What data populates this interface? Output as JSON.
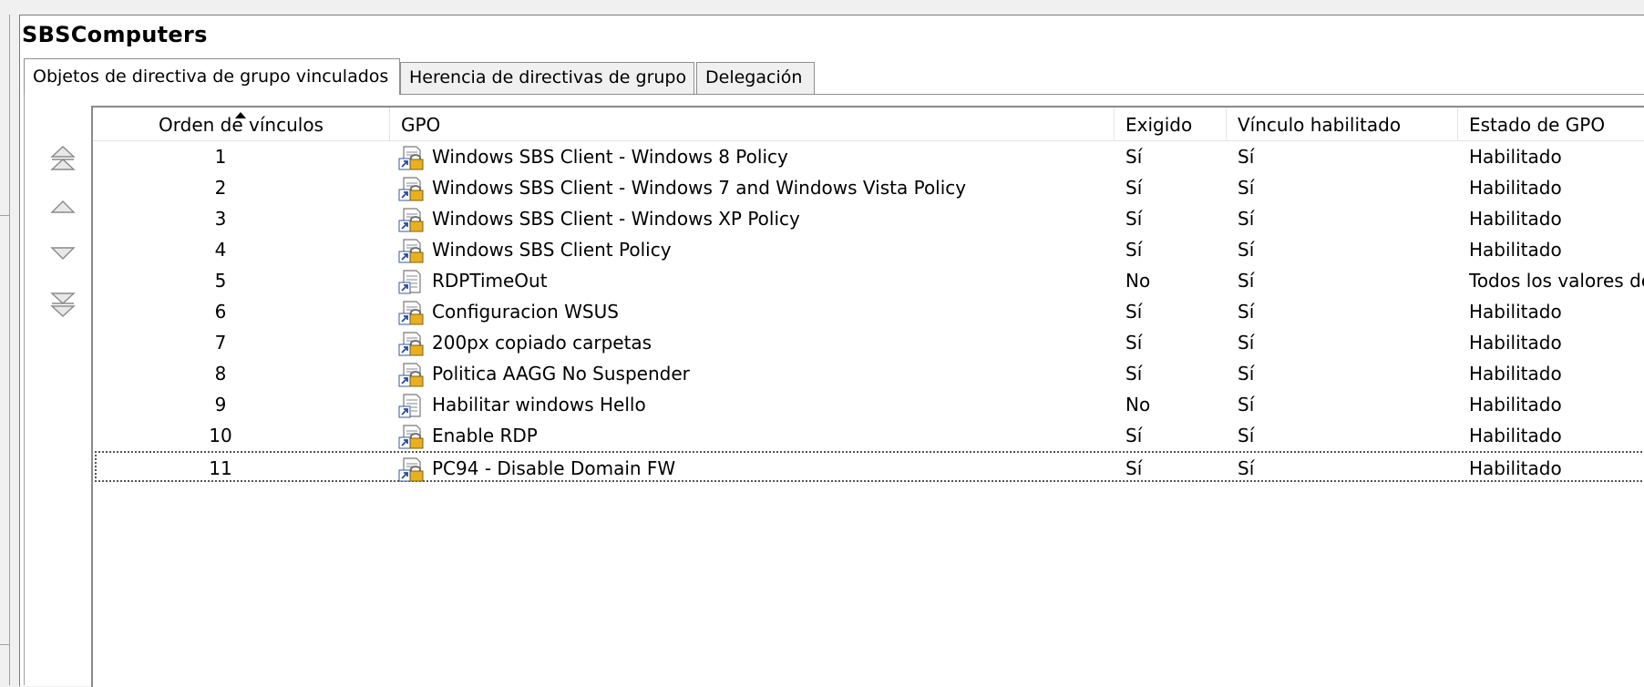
{
  "page": {
    "title": "SBSComputers"
  },
  "tabs": [
    {
      "label": "Objetos de directiva de grupo vinculados",
      "active": true
    },
    {
      "label": "Herencia de directivas de grupo",
      "active": false
    },
    {
      "label": "Delegación",
      "active": false
    }
  ],
  "order_buttons": [
    {
      "name": "move-to-top",
      "icon": "double-chevron-up-icon"
    },
    {
      "name": "move-up",
      "icon": "chevron-up-icon"
    },
    {
      "name": "move-down",
      "icon": "chevron-down-icon"
    },
    {
      "name": "move-to-bottom",
      "icon": "double-chevron-down-icon"
    }
  ],
  "table": {
    "columns": [
      "Orden de vínculos",
      "GPO",
      "Exigido",
      "Vínculo habilitado",
      "Estado de GPO"
    ],
    "sort_column": "Orden de vínculos",
    "rows": [
      {
        "order": "1",
        "gpo": "Windows SBS Client - Windows 8 Policy",
        "icon": "enforced-gpo-link-icon",
        "enforced": "Sí",
        "link_enabled": "Sí",
        "status": "Habilitado"
      },
      {
        "order": "2",
        "gpo": "Windows SBS Client - Windows 7 and Windows Vista Policy",
        "icon": "enforced-gpo-link-icon",
        "enforced": "Sí",
        "link_enabled": "Sí",
        "status": "Habilitado"
      },
      {
        "order": "3",
        "gpo": "Windows SBS Client - Windows XP Policy",
        "icon": "enforced-gpo-link-icon",
        "enforced": "Sí",
        "link_enabled": "Sí",
        "status": "Habilitado"
      },
      {
        "order": "4",
        "gpo": "Windows SBS Client Policy",
        "icon": "enforced-gpo-link-icon",
        "enforced": "Sí",
        "link_enabled": "Sí",
        "status": "Habilitado"
      },
      {
        "order": "5",
        "gpo": "RDPTimeOut",
        "icon": "gpo-link-icon",
        "enforced": "No",
        "link_enabled": "Sí",
        "status": "Todos los valores de"
      },
      {
        "order": "6",
        "gpo": "Configuracion WSUS",
        "icon": "enforced-gpo-link-icon",
        "enforced": "Sí",
        "link_enabled": "Sí",
        "status": "Habilitado"
      },
      {
        "order": "7",
        "gpo": "200px copiado carpetas",
        "icon": "enforced-gpo-link-icon",
        "enforced": "Sí",
        "link_enabled": "Sí",
        "status": "Habilitado"
      },
      {
        "order": "8",
        "gpo": "Politica AAGG No Suspender",
        "icon": "enforced-gpo-link-icon",
        "enforced": "Sí",
        "link_enabled": "Sí",
        "status": "Habilitado"
      },
      {
        "order": "9",
        "gpo": "Habilitar windows Hello",
        "icon": "gpo-link-icon",
        "enforced": "No",
        "link_enabled": "Sí",
        "status": "Habilitado"
      },
      {
        "order": "10",
        "gpo": "Enable RDP",
        "icon": "enforced-gpo-link-icon",
        "enforced": "Sí",
        "link_enabled": "Sí",
        "status": "Habilitado"
      },
      {
        "order": "11",
        "gpo": "PC94 - Disable Domain FW",
        "icon": "enforced-gpo-link-icon",
        "enforced": "Sí",
        "link_enabled": "Sí",
        "status": "Habilitado",
        "focused": true
      }
    ]
  }
}
